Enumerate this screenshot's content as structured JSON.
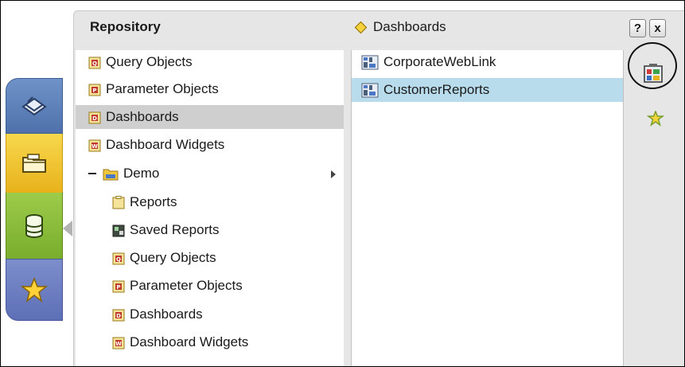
{
  "repository": {
    "title": "Repository",
    "breadcrumb": "Dashboards",
    "help_label": "?",
    "close_label": "x"
  },
  "tree": {
    "items": [
      {
        "label": "Query Objects",
        "icon": "query-object-icon",
        "letter": "Q"
      },
      {
        "label": "Parameter Objects",
        "icon": "parameter-object-icon",
        "letter": "P"
      },
      {
        "label": "Dashboards",
        "icon": "dashboard-icon",
        "letter": "D",
        "selected": true
      },
      {
        "label": "Dashboard Widgets",
        "icon": "dashboard-widget-icon",
        "letter": "W"
      },
      {
        "label": "Demo",
        "icon": "folder-icon",
        "expanded": true
      },
      {
        "label": "Reports",
        "icon": "report-icon"
      },
      {
        "label": "Saved Reports",
        "icon": "saved-report-icon"
      },
      {
        "label": "Query Objects",
        "icon": "query-object-icon",
        "letter": "Q"
      },
      {
        "label": "Parameter Objects",
        "icon": "parameter-object-icon",
        "letter": "P"
      },
      {
        "label": "Dashboards",
        "icon": "dashboard-icon",
        "letter": "D"
      },
      {
        "label": "Dashboard Widgets",
        "icon": "dashboard-widget-icon",
        "letter": "W"
      }
    ]
  },
  "contents": {
    "items": [
      {
        "label": "CorporateWebLink",
        "icon": "dashboard-file-icon"
      },
      {
        "label": "CustomerReports",
        "icon": "dashboard-file-icon",
        "selected": true
      }
    ]
  },
  "side_tabs": [
    {
      "name": "home",
      "color": "#5a7db8"
    },
    {
      "name": "files",
      "color": "#f0c52c"
    },
    {
      "name": "database",
      "color": "#8bbd3b"
    },
    {
      "name": "favorites",
      "color": "#6a7cc0"
    }
  ],
  "colors": {
    "selected_gray": "#cfcfcf",
    "selected_blue": "#b9dcec",
    "panel_bg": "#e6e6e6"
  }
}
